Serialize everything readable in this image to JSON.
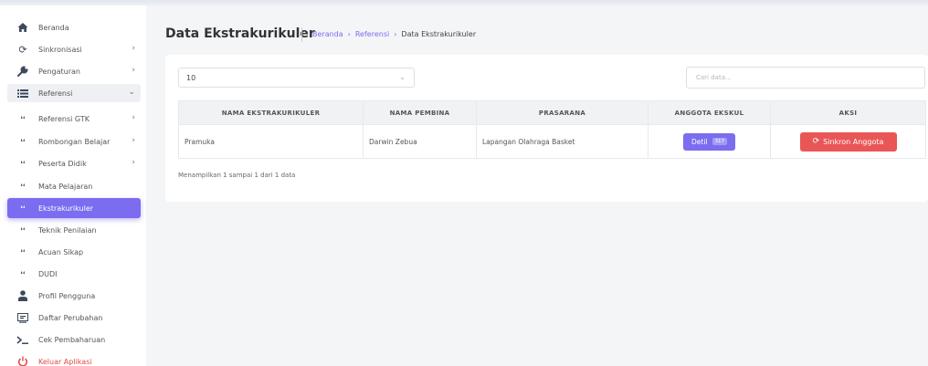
{
  "sidebar": {
    "items": [
      {
        "key": "beranda",
        "label": "Beranda",
        "icon": "home-icon"
      },
      {
        "key": "sinkronisasi",
        "label": "Sinkronisasi",
        "icon": "sync-icon",
        "chevron": "›"
      },
      {
        "key": "pengaturan",
        "label": "Pengaturan",
        "icon": "wrench-icon",
        "chevron": "›"
      },
      {
        "key": "referensi",
        "label": "Referensi",
        "icon": "list-icon",
        "chevron": "⌄"
      },
      {
        "key": "referensi-gtk",
        "label": "Referensi GTK",
        "icon": "sub-icon",
        "chevron": "›"
      },
      {
        "key": "rombongan-belajar",
        "label": "Rombongan Belajar",
        "icon": "sub-icon",
        "chevron": "›"
      },
      {
        "key": "peserta-didik",
        "label": "Peserta Didik",
        "icon": "sub-icon",
        "chevron": "›"
      },
      {
        "key": "mata-pelajaran",
        "label": "Mata Pelajaran",
        "icon": "sub-icon"
      },
      {
        "key": "ekstrakurikuler",
        "label": "Ekstrakurikuler",
        "icon": "sub-icon"
      },
      {
        "key": "teknik-penilaian",
        "label": "Teknik Penilaian",
        "icon": "sub-icon"
      },
      {
        "key": "acuan-sikap",
        "label": "Acuan Sikap",
        "icon": "sub-icon"
      },
      {
        "key": "dudi",
        "label": "DUDI",
        "icon": "sub-icon"
      },
      {
        "key": "profil-pengguna",
        "label": "Profil Pengguna",
        "icon": "user-icon"
      },
      {
        "key": "daftar-perubahan",
        "label": "Daftar Perubahan",
        "icon": "changelog-icon"
      },
      {
        "key": "cek-pembaharuan",
        "label": "Cek Pembaharuan",
        "icon": "terminal-icon"
      },
      {
        "key": "keluar-aplikasi",
        "label": "Keluar Aplikasi",
        "icon": "power-icon"
      }
    ]
  },
  "header": {
    "title": "Data Ekstrakurikuler",
    "breadcrumb": {
      "home": "Beranda",
      "sep": "›",
      "parent": "Referensi",
      "current": "Data Ekstrakurikuler"
    }
  },
  "controls": {
    "page_size": "10",
    "page_size_chevron": "⌄",
    "search_placeholder": "Cari data..."
  },
  "table": {
    "headers": [
      "NAMA EKSTRAKURIKULER",
      "NAMA PEMBINA",
      "PRASARANA",
      "ANGGOTA EKSKUL",
      "AKSI"
    ],
    "rows": [
      {
        "nama": "Pramuka",
        "pembina": "Darwin Zebua",
        "prasarana": "Lapangan Olahraga Basket",
        "detil_label": "Detil",
        "anggota_count": "317",
        "aksi_label": "Sinkron Anggota",
        "aksi_icon": "refresh-icon"
      }
    ]
  },
  "footer": {
    "info": "Menampilkan 1 sampai 1 dari 1 data"
  },
  "colors": {
    "accent": "#7b6cf0",
    "danger": "#e95656",
    "background": "#f4f5f7"
  }
}
